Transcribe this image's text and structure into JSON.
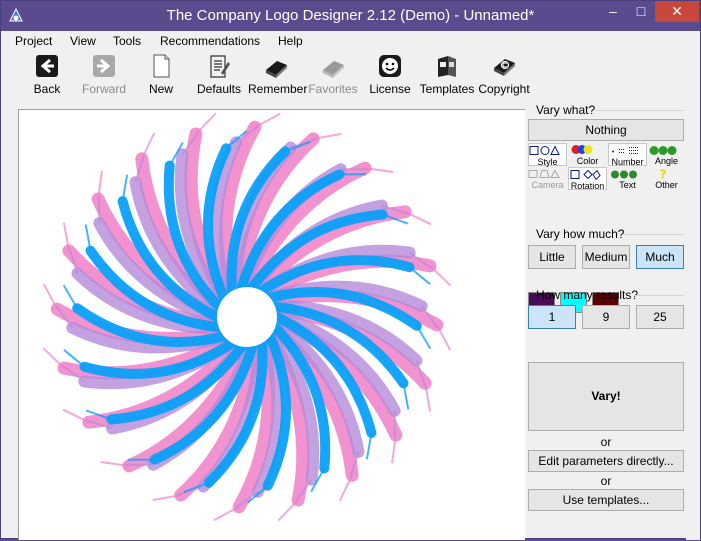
{
  "window": {
    "title": "The Company Logo Designer 2.12 (Demo) - Unnamed*",
    "controls": {
      "minimize": "–",
      "maximize": "□",
      "close": "✕"
    }
  },
  "menu": [
    "Project",
    "View",
    "Tools",
    "Recommendations",
    "Help"
  ],
  "toolbar": [
    {
      "label": "Back",
      "icon": "back-arrow-icon",
      "enabled": true
    },
    {
      "label": "Forward",
      "icon": "forward-arrow-icon",
      "enabled": false
    },
    {
      "label": "New",
      "icon": "new-page-icon",
      "enabled": true
    },
    {
      "label": "Defaults",
      "icon": "document-list-icon",
      "enabled": true
    },
    {
      "label": "Remember",
      "icon": "book-icon",
      "enabled": true
    },
    {
      "label": "Favorites",
      "icon": "book-icon",
      "enabled": false
    },
    {
      "label": "License",
      "icon": "smiley-icon",
      "enabled": true
    },
    {
      "label": "Templates",
      "icon": "templates-icon",
      "enabled": true
    },
    {
      "label": "Copyright",
      "icon": "copyright-book-icon",
      "enabled": true
    }
  ],
  "panel": {
    "vary_what_title": "Vary what?",
    "nothing_button": "Nothing",
    "tabs_row1": [
      {
        "label": "Style",
        "active": true
      },
      {
        "label": "Color",
        "active": false
      },
      {
        "label": "Number",
        "active": true
      },
      {
        "label": "Angle",
        "active": false
      }
    ],
    "tabs_row2": [
      {
        "label": "Camera",
        "disabled": true
      },
      {
        "label": "Rotation",
        "active": true
      },
      {
        "label": "Text",
        "active": false
      },
      {
        "label": "Other",
        "active": false
      }
    ],
    "swatches": [
      "#4a0a5a",
      "#00ffff",
      "#5a0000"
    ],
    "vary_how_much_title": "Vary how much?",
    "how_much": [
      {
        "label": "Little",
        "selected": false
      },
      {
        "label": "Medium",
        "selected": false
      },
      {
        "label": "Much",
        "selected": true
      }
    ],
    "how_many_title": "How many results?",
    "results": [
      {
        "label": "1",
        "selected": true
      },
      {
        "label": "9",
        "selected": false
      },
      {
        "label": "25",
        "selected": false
      }
    ],
    "vary_button": "Vary!",
    "or1": "or",
    "edit_button": "Edit parameters directly...",
    "or2": "or",
    "templates_button": "Use templates..."
  },
  "colors": {
    "titlebar": "#5a4b8f",
    "close_button": "#c7473d",
    "logo_primary": "#0aa0f8",
    "logo_pink": "#f080c8",
    "logo_purple": "#b58ad8"
  }
}
